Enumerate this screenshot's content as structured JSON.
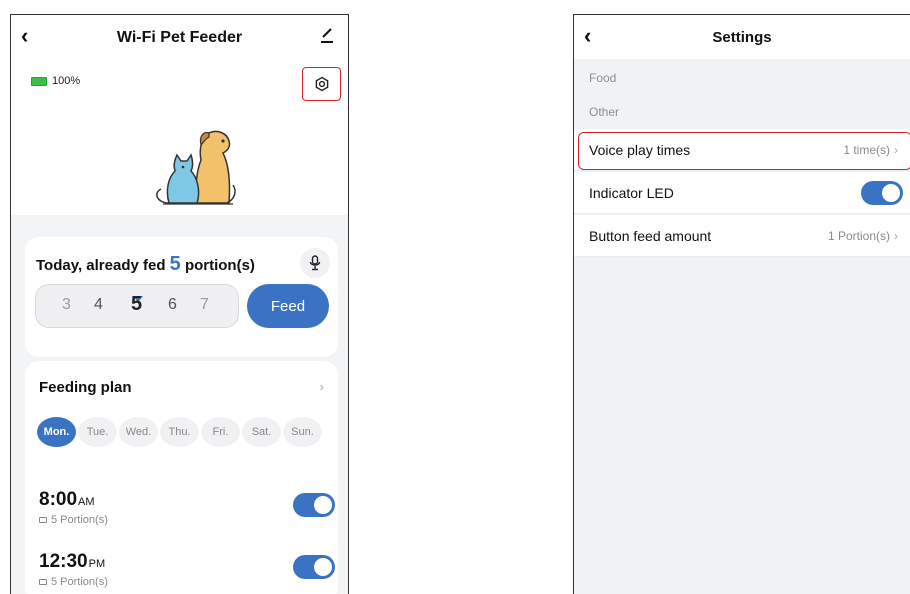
{
  "left": {
    "title": "Wi-Fi Pet Feeder",
    "battery": "100%",
    "feed": {
      "prefix": "Today, already fed ",
      "count": "5",
      "suffix": " portion(s)",
      "picker": [
        "3",
        "4",
        "5",
        "6",
        "7"
      ],
      "feed_label": "Feed"
    },
    "plan": {
      "title": "Feeding plan",
      "chevron": "›",
      "days": [
        "Mon.",
        "Tue.",
        "Wed.",
        "Thu.",
        "Fri.",
        "Sat.",
        "Sun."
      ],
      "items": [
        {
          "time": "8:00",
          "ampm": "AM",
          "portion": "5 Portion(s)",
          "enabled": true
        },
        {
          "time": "12:30",
          "ampm": "PM",
          "portion": "5 Portion(s)",
          "enabled": true
        }
      ]
    }
  },
  "right": {
    "title": "Settings",
    "sections": [
      "Food",
      "Other"
    ],
    "rows": [
      {
        "label": "Voice play times",
        "value": "1 time(s)",
        "chevron": "›"
      },
      {
        "label": "Indicator LED",
        "toggle": true
      },
      {
        "label": "Button feed amount",
        "value": "1 Portion(s)",
        "chevron": "›"
      }
    ]
  },
  "icons": {
    "back": "chevron-left-icon",
    "edit": "pencil-icon",
    "settings": "gear-icon",
    "mic": "microphone-icon"
  },
  "colors": {
    "accent": "#3b73c4",
    "highlight": "#d9232a",
    "battery": "#3cbf4a"
  }
}
